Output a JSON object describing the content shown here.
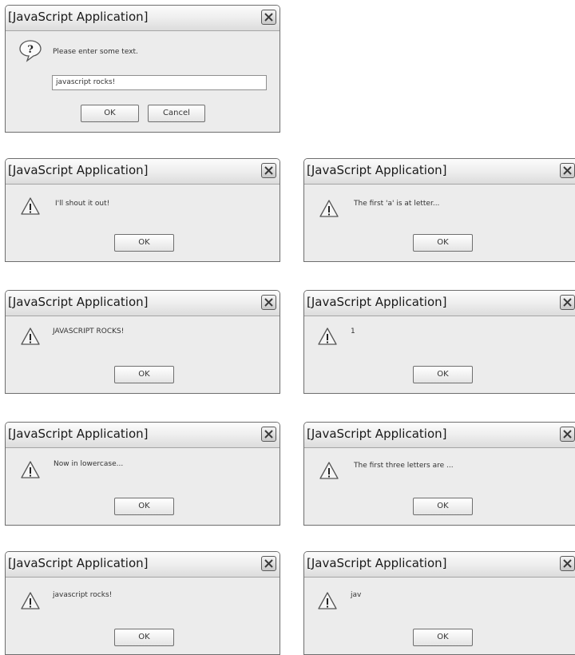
{
  "prompt_dialog": {
    "title": "[JavaScript Application]",
    "message": "Please enter some text.",
    "input_value": "javascript rocks!",
    "ok_label": "OK",
    "cancel_label": "Cancel",
    "icon": "question-speech-bubble-icon"
  },
  "alerts": [
    {
      "title": "[JavaScript Application]",
      "message": "I'll shout it out!",
      "ok_label": "OK",
      "icon": "warning-icon"
    },
    {
      "title": "[JavaScript Application]",
      "message": "The first 'a' is at letter...",
      "ok_label": "OK",
      "icon": "warning-icon"
    },
    {
      "title": "[JavaScript Application]",
      "message": "JAVASCRIPT ROCKS!",
      "ok_label": "OK",
      "icon": "warning-icon"
    },
    {
      "title": "[JavaScript Application]",
      "message": "1",
      "ok_label": "OK",
      "icon": "warning-icon"
    },
    {
      "title": "[JavaScript Application]",
      "message": "Now in lowercase...",
      "ok_label": "OK",
      "icon": "warning-icon"
    },
    {
      "title": "[JavaScript Application]",
      "message": "The first three letters are ...",
      "ok_label": "OK",
      "icon": "warning-icon"
    },
    {
      "title": "[JavaScript Application]",
      "message": "javascript rocks!",
      "ok_label": "OK",
      "icon": "warning-icon"
    },
    {
      "title": "[JavaScript Application]",
      "message": "jav",
      "ok_label": "OK",
      "icon": "warning-icon"
    }
  ]
}
